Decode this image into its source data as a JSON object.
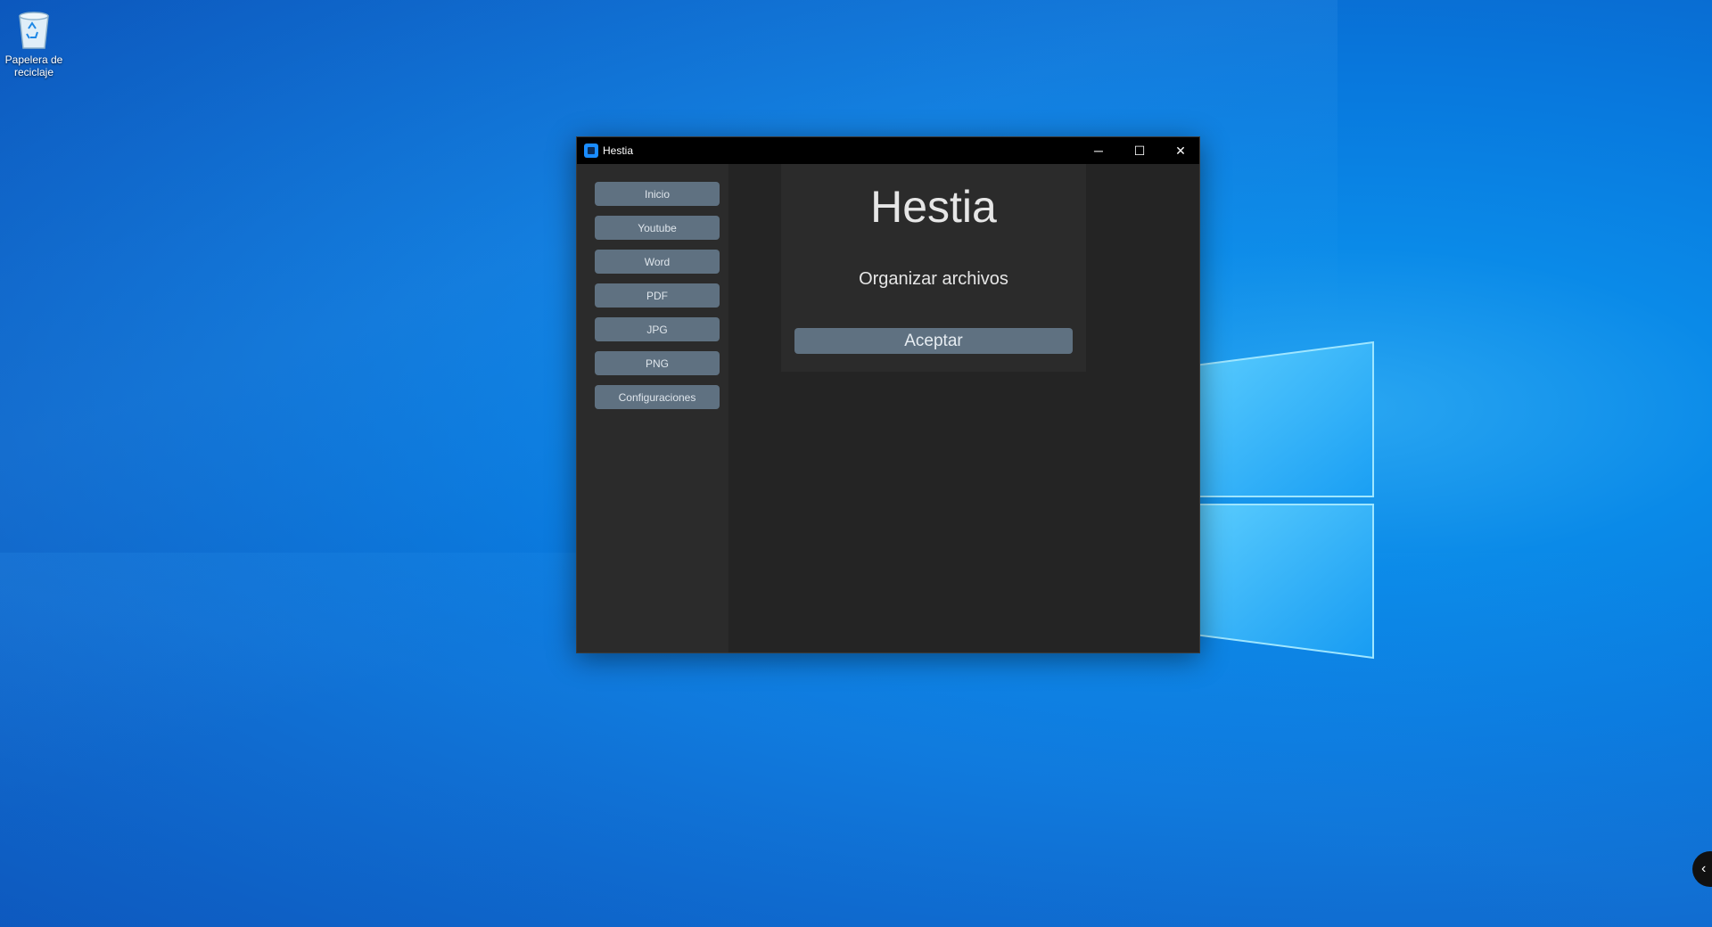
{
  "desktop": {
    "icons": [
      {
        "label": "Papelera de reciclaje",
        "icon": "recycle-bin-icon"
      }
    ]
  },
  "window": {
    "title": "Hestia",
    "controls": {
      "minimize": "─",
      "maximize": "☐",
      "close": "✕"
    }
  },
  "sidebar": {
    "items": [
      {
        "label": "Inicio"
      },
      {
        "label": "Youtube"
      },
      {
        "label": "Word"
      },
      {
        "label": "PDF"
      },
      {
        "label": "JPG"
      },
      {
        "label": "PNG"
      },
      {
        "label": "Configuraciones"
      }
    ]
  },
  "main": {
    "heading": "Hestia",
    "subtitle": "Organizar archivos",
    "accept_label": "Aceptar"
  },
  "edge_tab": {
    "glyph": "‹"
  },
  "colors": {
    "desktop_blue": "#0878dd",
    "titlebar": "#000000",
    "sidebar_bg": "#2b2b2b",
    "main_bg": "#242424",
    "button_bg": "#5f7181",
    "app_icon_accent": "#1a8cff"
  }
}
